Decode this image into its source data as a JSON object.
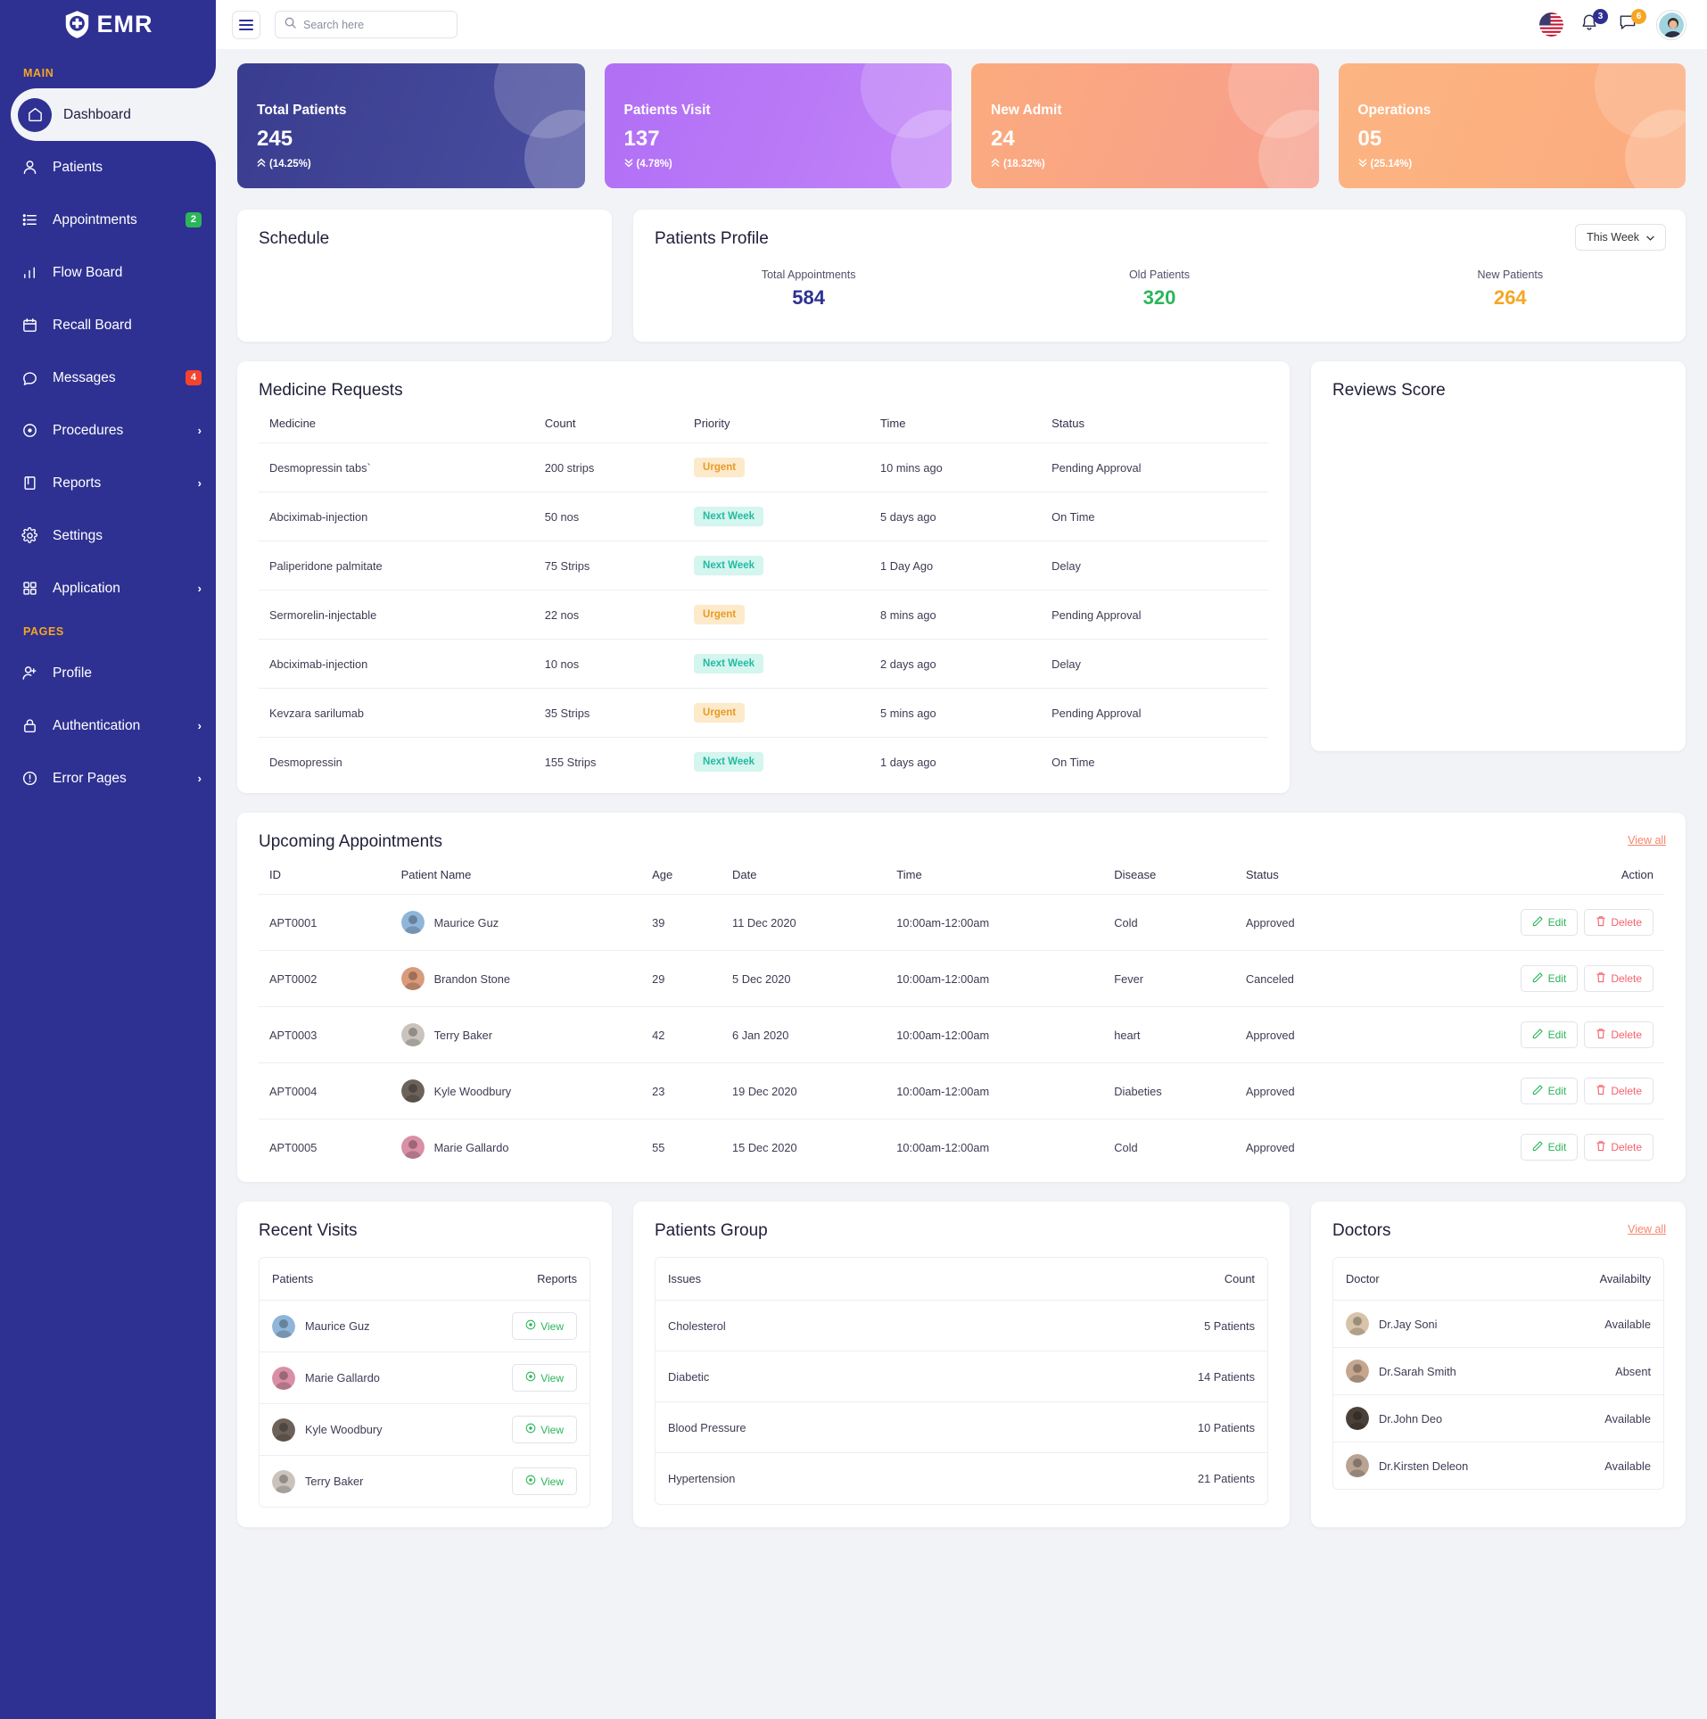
{
  "brand": {
    "name": "EMR",
    "logo_icon": "shield-medical-icon"
  },
  "sidebar": {
    "section_main": "MAIN",
    "section_pages": "PAGES",
    "main_items": [
      {
        "label": "Dashboard",
        "icon": "home-icon",
        "active": true
      },
      {
        "label": "Patients",
        "icon": "user-icon"
      },
      {
        "label": "Appointments",
        "icon": "list-icon",
        "badge": "2",
        "badge_color": "#2bb659"
      },
      {
        "label": "Flow Board",
        "icon": "bar-chart-icon"
      },
      {
        "label": "Recall Board",
        "icon": "calendar-icon"
      },
      {
        "label": "Messages",
        "icon": "chat-icon",
        "badge": "4",
        "badge_color": "#f4442e"
      },
      {
        "label": "Procedures",
        "icon": "target-icon",
        "caret": "›"
      },
      {
        "label": "Reports",
        "icon": "book-icon",
        "caret": "›"
      },
      {
        "label": "Settings",
        "icon": "gear-icon"
      },
      {
        "label": "Application",
        "icon": "grid-icon",
        "caret": "›"
      }
    ],
    "pages_items": [
      {
        "label": "Profile",
        "icon": "user-add-icon"
      },
      {
        "label": "Authentication",
        "icon": "lock-icon",
        "caret": "›"
      },
      {
        "label": "Error Pages",
        "icon": "alert-icon",
        "caret": "›"
      }
    ]
  },
  "topbar": {
    "menu_icon": "hamburger-icon",
    "search_placeholder": "Search here",
    "search_value": "",
    "search_icon": "search-icon",
    "flag_icon": "us-flag-icon",
    "bell_icon": "bell-icon",
    "bell_count": "3",
    "chat_icon": "message-icon",
    "chat_count": "6",
    "avatar_icon": "user-avatar"
  },
  "stats": [
    {
      "title": "Total Patients",
      "value": "245",
      "delta": "(14.25%)",
      "dir": "up",
      "c1": "#3a3d8f",
      "c2": "#4a4e9f"
    },
    {
      "title": "Patients Visit",
      "value": "137",
      "delta": "(4.78%)",
      "dir": "down",
      "c1": "#b16ff5",
      "c2": "#c183f8"
    },
    {
      "title": "New Admit",
      "value": "24",
      "delta": "(18.32%)",
      "dir": "up",
      "c1": "#fbab7e",
      "c2": "#f79d8c"
    },
    {
      "title": "Operations",
      "value": "05",
      "delta": "(25.14%)",
      "dir": "down",
      "c1": "#fcb482",
      "c2": "#fbab7e"
    }
  ],
  "schedule": {
    "title": "Schedule"
  },
  "patients_profile": {
    "title": "Patients Profile",
    "filter_label": "This Week",
    "stats": [
      {
        "label": "Total Appointments",
        "value": "584",
        "color": "#2e3192"
      },
      {
        "label": "Old Patients",
        "value": "320",
        "color": "#2bb659"
      },
      {
        "label": "New Patients",
        "value": "264",
        "color": "#f5a623"
      }
    ]
  },
  "medicine_requests": {
    "title": "Medicine Requests",
    "columns": [
      "Medicine",
      "Count",
      "Priority",
      "Time",
      "Status"
    ],
    "rows": [
      {
        "medicine": "Desmopressin tabs`",
        "count": "200 strips",
        "priority": "Urgent",
        "ptype": "urgent",
        "time": "10 mins ago",
        "status": "Pending Approval",
        "stype": "pending"
      },
      {
        "medicine": "Abciximab-injection",
        "count": "50 nos",
        "priority": "Next Week",
        "ptype": "next",
        "time": "5 days ago",
        "status": "On Time",
        "stype": "ontime"
      },
      {
        "medicine": "Paliperidone palmitate",
        "count": "75 Strips",
        "priority": "Next Week",
        "ptype": "next",
        "time": "1 Day Ago",
        "status": "Delay",
        "stype": "delay"
      },
      {
        "medicine": "Sermorelin-injectable",
        "count": "22 nos",
        "priority": "Urgent",
        "ptype": "urgent",
        "time": "8 mins ago",
        "status": "Pending Approval",
        "stype": "pending"
      },
      {
        "medicine": "Abciximab-injection",
        "count": "10 nos",
        "priority": "Next Week",
        "ptype": "next",
        "time": "2 days ago",
        "status": "Delay",
        "stype": "delay"
      },
      {
        "medicine": "Kevzara sarilumab",
        "count": "35 Strips",
        "priority": "Urgent",
        "ptype": "urgent",
        "time": "5 mins ago",
        "status": "Pending Approval",
        "stype": "pending"
      },
      {
        "medicine": "Desmopressin",
        "count": "155 Strips",
        "priority": "Next Week",
        "ptype": "next",
        "time": "1 days ago",
        "status": "On Time",
        "stype": "ontime"
      }
    ]
  },
  "reviews_score": {
    "title": "Reviews Score"
  },
  "appointments": {
    "title": "Upcoming Appointments",
    "view_all": "View all",
    "columns": [
      "ID",
      "Patient Name",
      "Age",
      "Date",
      "Time",
      "Disease",
      "Status",
      "Action"
    ],
    "edit_label": "Edit",
    "delete_label": "Delete",
    "rows": [
      {
        "id": "APT0001",
        "name": "Maurice Guz",
        "age": "39",
        "date": "11 Dec 2020",
        "time": "10:00am-12:00am",
        "disease": "Cold",
        "status": "Approved",
        "stype": "approved",
        "av": "#8fb5d8"
      },
      {
        "id": "APT0002",
        "name": "Brandon Stone",
        "age": "29",
        "date": "5 Dec 2020",
        "time": "10:00am-12:00am",
        "disease": "Fever",
        "status": "Canceled",
        "stype": "canceled",
        "av": "#d99b7c"
      },
      {
        "id": "APT0003",
        "name": "Terry Baker",
        "age": "42",
        "date": "6 Jan 2020",
        "time": "10:00am-12:00am",
        "disease": "heart",
        "status": "Approved",
        "stype": "approved",
        "av": "#c9c3bb"
      },
      {
        "id": "APT0004",
        "name": "Kyle Woodbury",
        "age": "23",
        "date": "19 Dec 2020",
        "time": "10:00am-12:00am",
        "disease": "Diabeties",
        "status": "Approved",
        "stype": "approved",
        "av": "#6d6259"
      },
      {
        "id": "APT0005",
        "name": "Marie Gallardo",
        "age": "55",
        "date": "15 Dec 2020",
        "time": "10:00am-12:00am",
        "disease": "Cold",
        "status": "Approved",
        "stype": "approved",
        "av": "#d98fa5"
      }
    ]
  },
  "recent_visits": {
    "title": "Recent Visits",
    "columns": [
      "Patients",
      "Reports"
    ],
    "view_label": "View",
    "rows": [
      {
        "name": "Maurice Guz",
        "av": "#8fb5d8"
      },
      {
        "name": "Marie Gallardo",
        "av": "#d98fa5"
      },
      {
        "name": "Kyle Woodbury",
        "av": "#6d6259"
      },
      {
        "name": "Terry Baker",
        "av": "#c9c3bb"
      }
    ]
  },
  "patients_group": {
    "title": "Patients Group",
    "columns": [
      "Issues",
      "Count"
    ],
    "rows": [
      {
        "issue": "Cholesterol",
        "count": "5 Patients"
      },
      {
        "issue": "Diabetic",
        "count": "14 Patients"
      },
      {
        "issue": "Blood Pressure",
        "count": "10 Patients"
      },
      {
        "issue": "Hypertension",
        "count": "21 Patients"
      }
    ]
  },
  "doctors": {
    "title": "Doctors",
    "view_all": "View all",
    "columns": [
      "Doctor",
      "Availabilty"
    ],
    "rows": [
      {
        "name": "Dr.Jay Soni",
        "status": "Available",
        "stype": "avail",
        "av": "#d7c4a8"
      },
      {
        "name": "Dr.Sarah Smith",
        "status": "Absent",
        "stype": "absent",
        "av": "#c5a68e"
      },
      {
        "name": "Dr.John Deo",
        "status": "Available",
        "stype": "avail",
        "av": "#4a4038"
      },
      {
        "name": "Dr.Kirsten Deleon",
        "status": "Available",
        "stype": "avail",
        "av": "#b9a392"
      }
    ]
  }
}
